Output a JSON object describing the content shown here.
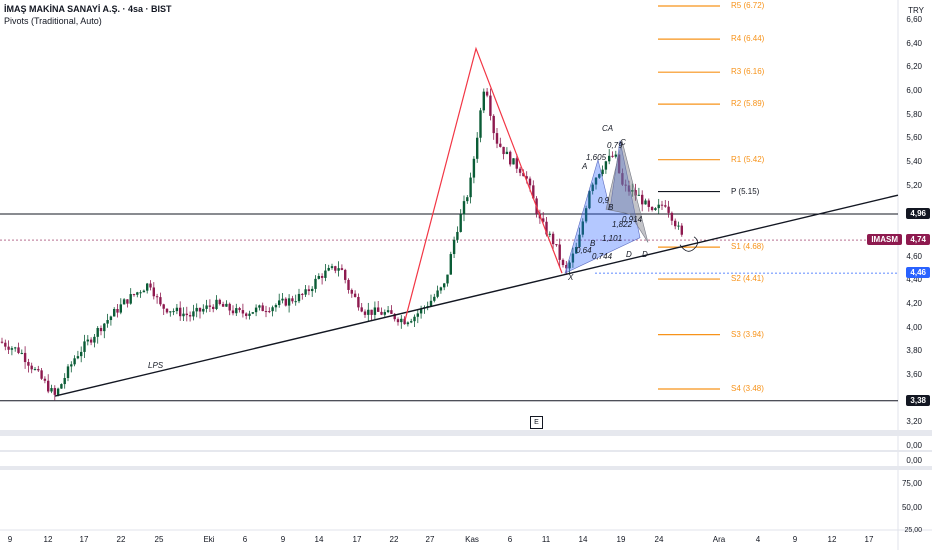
{
  "header": {
    "symbol_title": "İMAŞ MAKİNA SANAYİ A.Ş. · 4sa · BIST",
    "indicator": "Pivots (Traditional, Auto)"
  },
  "currency": "TRY",
  "price_axis": [
    "6,60",
    "6,40",
    "6,20",
    "6,00",
    "5,80",
    "5,60",
    "5,40",
    "5,20",
    "4,60",
    "4,40",
    "4,20",
    "4,00",
    "3,80",
    "3,60",
    "3,20"
  ],
  "badges": {
    "upper_level": "4,96",
    "ticker": "IMASM",
    "last_price": "4,74",
    "support_dotted": "4,46",
    "lower_level": "3,38"
  },
  "pivots": [
    {
      "label": "R5 (6.72)",
      "value": 6.72
    },
    {
      "label": "R4 (6.44)",
      "value": 6.44
    },
    {
      "label": "R3 (6.16)",
      "value": 6.16
    },
    {
      "label": "R2 (5.89)",
      "value": 5.89
    },
    {
      "label": "R1 (5.42)",
      "value": 5.42
    },
    {
      "label": "P (5.15)",
      "value": 5.15
    },
    {
      "label": "S1 (4.68)",
      "value": 4.68
    },
    {
      "label": "S2 (4.41)",
      "value": 4.41
    },
    {
      "label": "S3 (3.94)",
      "value": 3.94
    },
    {
      "label": "S4 (3.48)",
      "value": 3.48
    }
  ],
  "pattern_labels": {
    "lps": "LPS",
    "ca": "CA",
    "c": "C",
    "a": "A",
    "b1": "B",
    "b2": "B",
    "x": "X",
    "d1": "D",
    "d2": "D",
    "r1": "1,605",
    "r2": "0,79",
    "r3": "0,9",
    "r4": "1,822",
    "r5": "0,914",
    "r6": "0,64",
    "r7": "1,101",
    "r8": "0,744"
  },
  "e_marker": "E",
  "sub_panes": {
    "pane1": [
      "0,00"
    ],
    "pane2": [
      "0,00"
    ],
    "pane3": [
      "75,00",
      "50,00",
      "25,00"
    ]
  },
  "date_axis": [
    "9",
    "12",
    "17",
    "22",
    "25",
    "Eki",
    "6",
    "9",
    "14",
    "17",
    "22",
    "27",
    "Kas",
    "6",
    "11",
    "14",
    "19",
    "24",
    "Ara",
    "4",
    "9",
    "12",
    "17"
  ],
  "colors": {
    "bull": "#0a5c36",
    "bear": "#8e1a4f",
    "pivot": "#f7931a",
    "trend": "#131722",
    "zigzag": "#f23645",
    "badge_ticker": "#8e1a4f",
    "badge_dotted": "#2962ff"
  },
  "chart_data": {
    "type": "candlestick",
    "title": "İMAŞ MAKİNA SANAYİ A.Ş. · 4sa · BIST",
    "y_unit": "TRY",
    "ylim": [
      3.15,
      6.72
    ],
    "last_price": 4.74,
    "horizontal_levels": [
      4.96,
      3.38
    ],
    "dotted_level": 4.46,
    "key_points": [
      {
        "date": "9",
        "close": 3.88
      },
      {
        "date": "14",
        "close": 3.5
      },
      {
        "date": "17",
        "close": 3.98
      },
      {
        "date": "22",
        "close": 4.3
      },
      {
        "date": "25",
        "close": 4.42
      },
      {
        "date": "Eki",
        "close": 4.16
      },
      {
        "date": "9",
        "close": 4.16
      },
      {
        "date": "14",
        "close": 4.5
      },
      {
        "date": "17",
        "close": 4.12
      },
      {
        "date": "22",
        "close": 4.08
      },
      {
        "date": "27",
        "close": 4.3
      },
      {
        "date": "Kas",
        "close": 6.2
      },
      {
        "date": "6",
        "close": 5.5
      },
      {
        "date": "11",
        "close": 4.5
      },
      {
        "date": "14",
        "close": 5.3
      },
      {
        "date": "19",
        "close": 5.1
      },
      {
        "date": "24",
        "close": 4.74
      }
    ]
  }
}
